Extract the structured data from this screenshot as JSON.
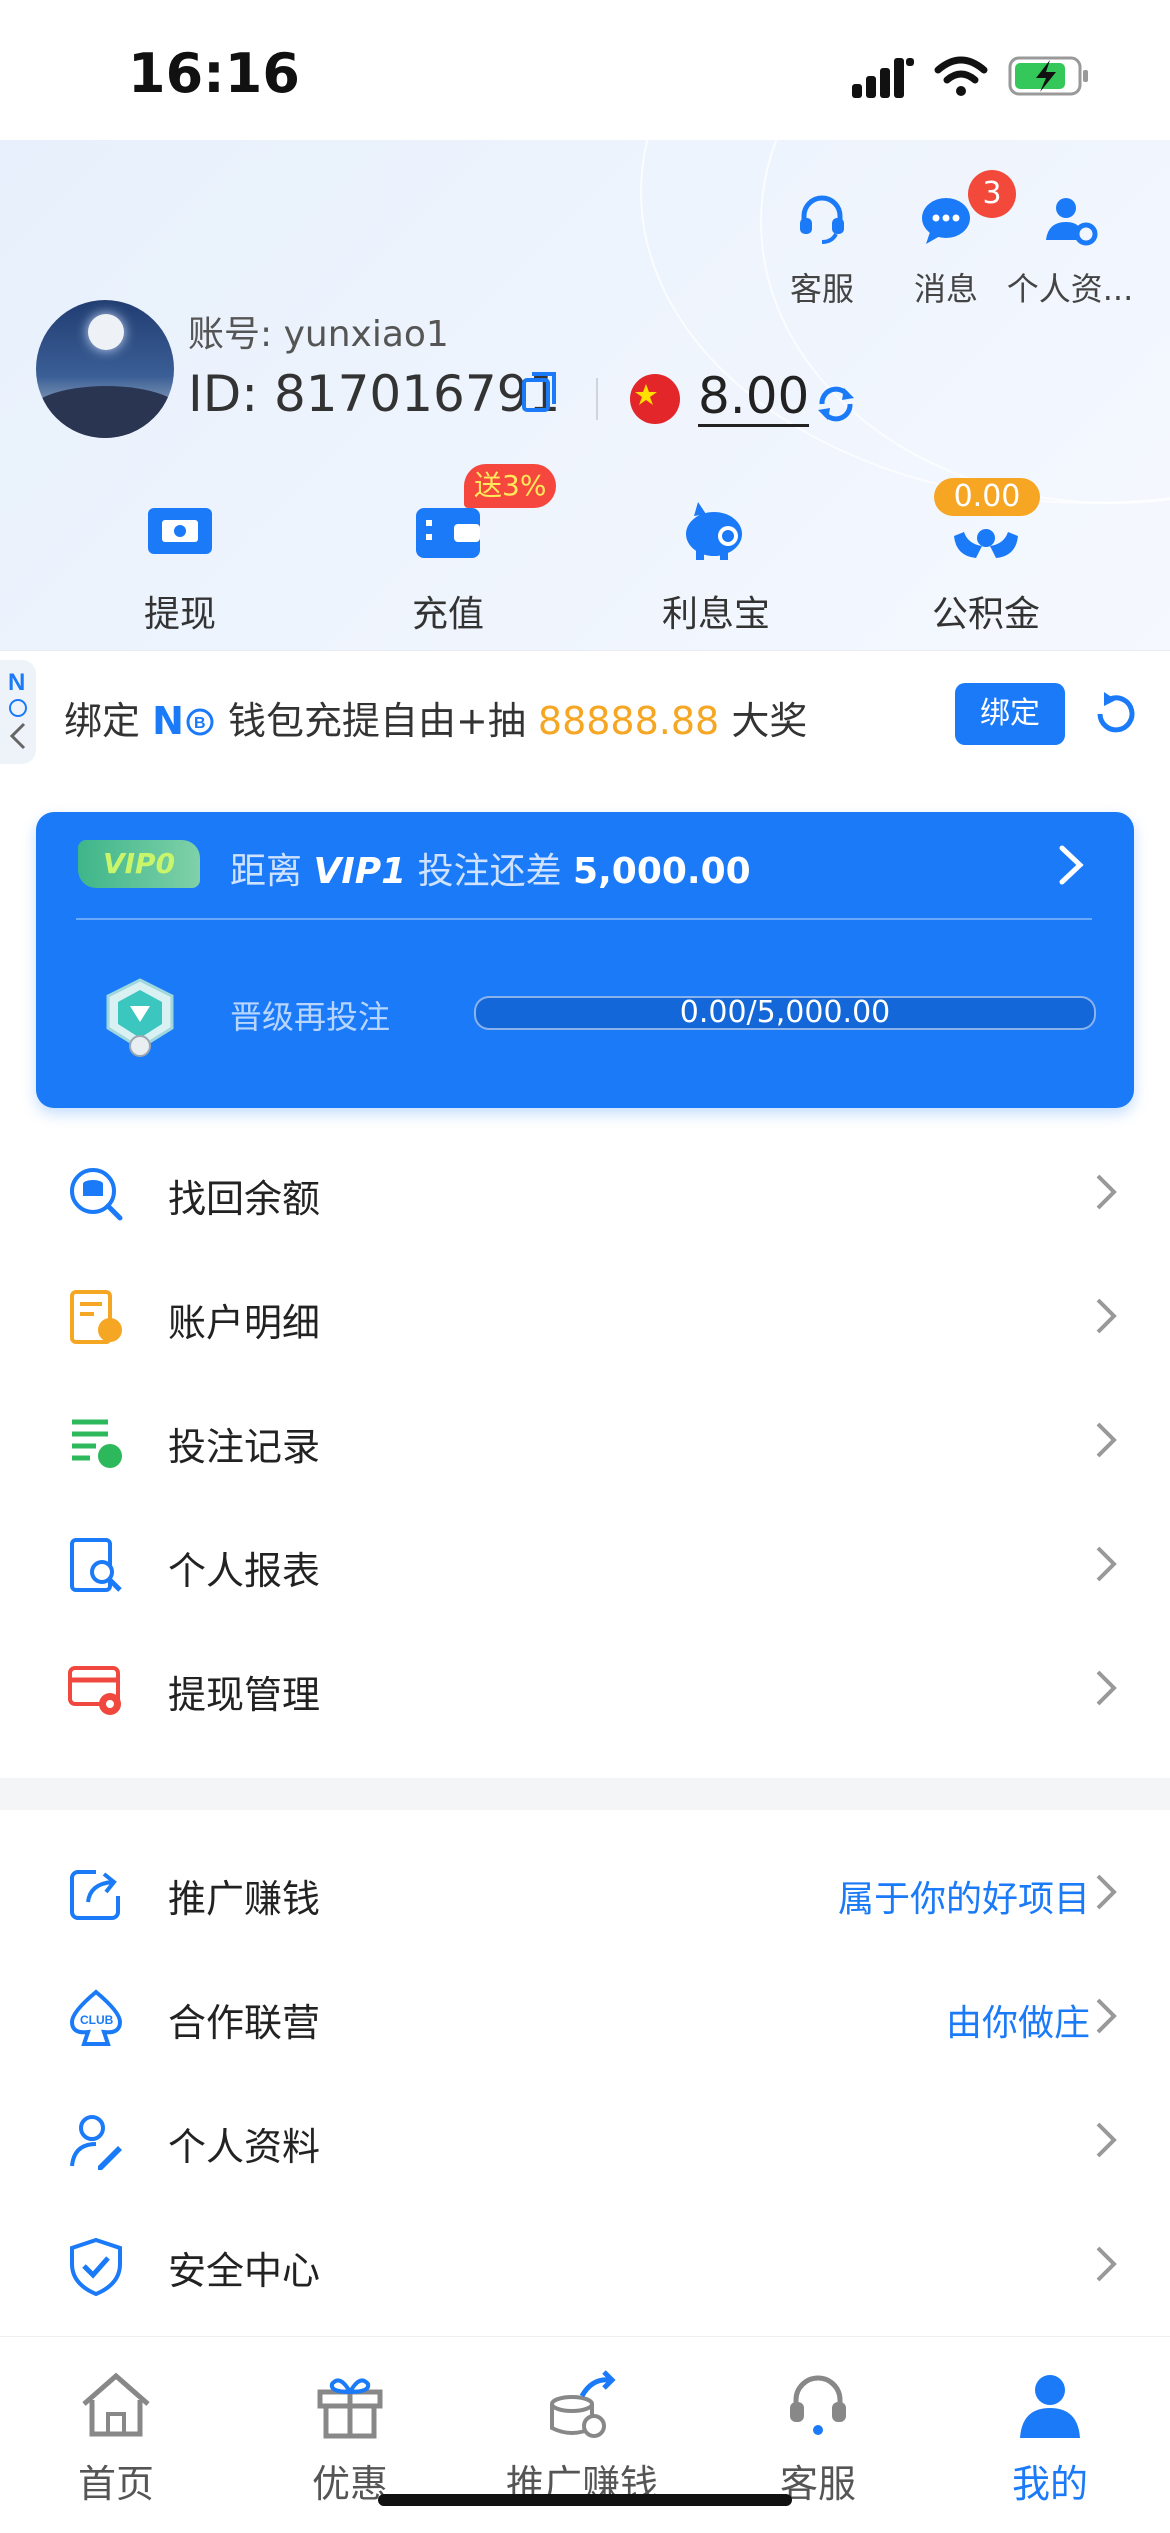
{
  "status_bar": {
    "time": "16:16"
  },
  "header": {
    "top_icons": [
      {
        "label": "客服",
        "icon": "headset-icon"
      },
      {
        "label": "消息",
        "icon": "chat-bubble-icon",
        "badge": "3"
      },
      {
        "label": "个人资...",
        "icon": "user-settings-icon"
      }
    ],
    "account_label": "账号: yunxiao1",
    "id_label": "ID: 817016791",
    "balance": "8.00",
    "actions": [
      {
        "label": "提现",
        "icon": "withdraw-ticket-icon"
      },
      {
        "label": "充值",
        "icon": "wallet-icon",
        "badge": "送3%"
      },
      {
        "label": "利息宝",
        "icon": "piggy-bank-icon"
      },
      {
        "label": "公积金",
        "icon": "hands-coin-icon",
        "badge": "0.00"
      }
    ]
  },
  "bind_banner": {
    "prefix": "绑定 ",
    "brand": "N",
    "middle": " 钱包充提自由+抽 ",
    "amount": "88888.88",
    "suffix": " 大奖",
    "button": "绑定"
  },
  "vip": {
    "badge": "VIP0",
    "distance_prefix": "距离 ",
    "next_level": "VIP1",
    "distance_mid": " 投注还差 ",
    "distance_amount": "5,000.00",
    "upgrade_label": "晋级再投注",
    "progress_text": "0.00/5,000.00",
    "progress_fraction": 0
  },
  "menu1": [
    {
      "label": "找回余额",
      "icon": "coin-search-icon",
      "color": "#1a7af8"
    },
    {
      "label": "账户明细",
      "icon": "account-detail-icon",
      "color": "#f5a623"
    },
    {
      "label": "投注记录",
      "icon": "bet-record-icon",
      "color": "#2eb85c"
    },
    {
      "label": "个人报表",
      "icon": "report-search-icon",
      "color": "#1a7af8"
    },
    {
      "label": "提现管理",
      "icon": "withdraw-settings-icon",
      "color": "#f0483e"
    }
  ],
  "menu2": [
    {
      "label": "推广赚钱",
      "icon": "share-icon",
      "right": "属于你的好项目"
    },
    {
      "label": "合作联营",
      "icon": "club-spade-icon",
      "right": "由你做庄"
    },
    {
      "label": "个人资料",
      "icon": "user-edit-icon",
      "right": ""
    },
    {
      "label": "安全中心",
      "icon": "shield-check-icon",
      "right": ""
    }
  ],
  "tabs": [
    {
      "label": "首页",
      "icon": "home-icon",
      "active": false
    },
    {
      "label": "优惠",
      "icon": "gift-icon",
      "active": false
    },
    {
      "label": "推广赚钱",
      "icon": "promote-coins-icon",
      "active": false
    },
    {
      "label": "客服",
      "icon": "headset-icon",
      "active": false
    },
    {
      "label": "我的",
      "icon": "user-icon",
      "active": true
    }
  ],
  "colors": {
    "accent": "#1a7af8",
    "badge_red": "#f2493b",
    "gold": "#f5a623"
  }
}
